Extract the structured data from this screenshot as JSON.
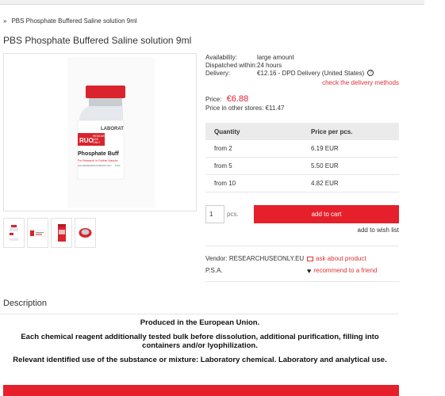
{
  "breadcrumb": {
    "separator": "»",
    "current": "PBS Phosphate Buffered Saline solution 9ml"
  },
  "product": {
    "title": "PBS Phosphate Buffered Saline solution 9ml",
    "vial": {
      "brand": "LABORAT",
      "badge": "RUO",
      "badge_text_1": "RESEARCH",
      "badge_text_2": "USE",
      "badge_text_3": "ONLY",
      "name": "Phosphate Buff",
      "sub": "For Research or Further Manufa",
      "code": "www.RESEARCHUSEONLY.EU",
      "code2": "Pack"
    }
  },
  "info": {
    "availability_label": "Availability:",
    "availability_value": "large amount",
    "dispatch_label": "Dispatched within:",
    "dispatch_value": "24 hours",
    "delivery_label": "Delivery:",
    "delivery_value": "€12.16 - DPD Delivery (United States)",
    "help_icon": "?",
    "delivery_link": "check the delivery methods"
  },
  "price": {
    "label": "Price:",
    "value": "€6.88",
    "other_label": "Price in other stores:",
    "other_value": "€11.47"
  },
  "price_table": {
    "headers": [
      "Quantity",
      "Price per pcs."
    ],
    "rows": [
      [
        "from 2",
        "6.19 EUR"
      ],
      [
        "from 5",
        "5.50 EUR"
      ],
      [
        "from 10",
        "4.82 EUR"
      ]
    ]
  },
  "cart": {
    "quantity": "1",
    "unit": "pcs.",
    "add_label": "add to cart",
    "wishlist_label": "add to wish list"
  },
  "vendor": {
    "vendor_label": "Vendor:",
    "vendor_value": "RESEARCHUSEONLY.EU",
    "psa": "P.S.A.",
    "ask_label": "ask about product",
    "recommend_label": "recommend to a friend"
  },
  "description": {
    "title": "Description",
    "lines": [
      "Produced in the European Union.",
      "Each chemical reagent additionally tested bulk before dissolution, additional purification, filling into containers and/or lyophilization.",
      "Relevant identified use of the substance or mixture: Laboratory chemical. Laboratory and analytical use."
    ]
  },
  "colors": {
    "accent": "#e6202b",
    "link": "#dd3333"
  }
}
